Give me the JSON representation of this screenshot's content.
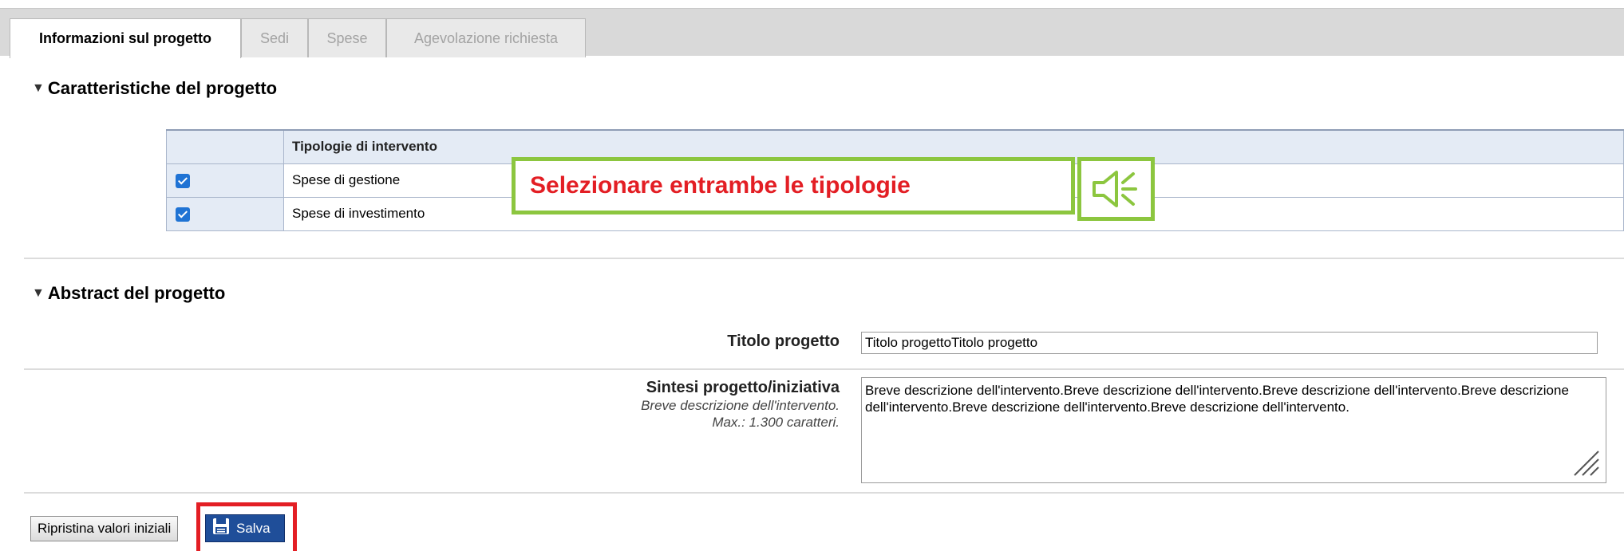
{
  "tabs": [
    {
      "label": "Informazioni sul progetto",
      "active": true
    },
    {
      "label": "Sedi",
      "active": false
    },
    {
      "label": "Spese",
      "active": false
    },
    {
      "label": "Agevolazione richiesta",
      "active": false
    }
  ],
  "section1": {
    "title": "Caratteristiche del progetto",
    "table": {
      "header": "Tipologie di intervento",
      "rows": [
        {
          "label": "Spese di gestione",
          "checked": true
        },
        {
          "label": "Spese di investimento",
          "checked": true
        }
      ]
    }
  },
  "callout": {
    "text": "Selezionare entrambe le tipologie",
    "icon": "speaker-icon",
    "border_color": "#8cc63f",
    "text_color": "#e31e24"
  },
  "section2": {
    "title": "Abstract del progetto",
    "titolo_label": "Titolo progetto",
    "titolo_value": "Titolo progettoTitolo progetto",
    "sintesi_label": "Sintesi progetto/iniziativa",
    "sintesi_help1": "Breve descrizione dell'intervento.",
    "sintesi_help2": "Max.: 1.300 caratteri.",
    "sintesi_value": "Breve descrizione dell'intervento.Breve descrizione dell'intervento.Breve descrizione dell'intervento.Breve descrizione dell'intervento.Breve descrizione dell'intervento.Breve descrizione dell'intervento."
  },
  "buttons": {
    "reset_label": "Ripristina valori iniziali",
    "save_label": "Salva",
    "save_icon": "floppy-disk-icon",
    "highlight_color": "#e31e24"
  }
}
